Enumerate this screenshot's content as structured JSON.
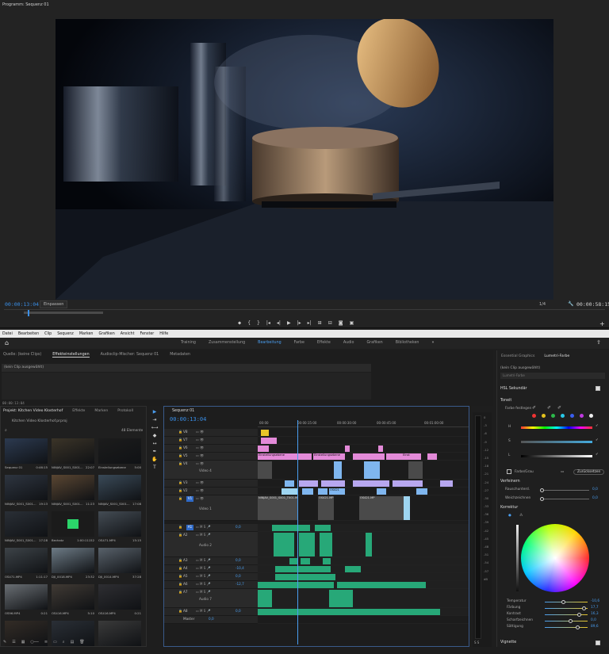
{
  "program": {
    "title": "Programm: Sequenz 01",
    "timecode": "00:00:13:04",
    "fit": "Einpassen",
    "quality": "1/4",
    "duration": "00:00:58:15"
  },
  "menu": [
    "Datei",
    "Bearbeiten",
    "Clip",
    "Sequenz",
    "Marken",
    "Grafiken",
    "Ansicht",
    "Fenster",
    "Hilfe"
  ],
  "workspaces": {
    "items": [
      "Training",
      "Zusammenstellung",
      "Bearbeitung",
      "Farbe",
      "Effekte",
      "Audio",
      "Grafiken",
      "Bibliotheken"
    ],
    "active": "Bearbeitung",
    "more": "»"
  },
  "source_panel": {
    "tabs": [
      "Quelle: (keine Clips)",
      "Effekteinstellungen",
      "Audioclip-Mischer: Sequenz 01",
      "Metadaten"
    ],
    "active": "Effekteinstellungen",
    "no_clip": "(kein Clip ausgewählt)",
    "timecode": "00:00:13:04"
  },
  "project": {
    "tabs": [
      "Projekt: Kitchen Video Klosterhof",
      "Effekte",
      "Marken",
      "Protokoll"
    ],
    "active": "Projekt: Kitchen Video Klosterhof",
    "file": "Kitchen Video Klosterhof.prproj",
    "count": "48 Elemente",
    "items": [
      {
        "name": "Sequenz 01",
        "dur": "0:46:15"
      },
      {
        "name": "NINJAV_S001_S001...",
        "dur": "22:07"
      },
      {
        "name": "Einstellungsebene",
        "dur": "5:00"
      },
      {
        "name": "NINJAV_S001_S001...",
        "dur": "19:13"
      },
      {
        "name": "NINJAV_S001_S001...",
        "dur": "11:23"
      },
      {
        "name": "NINJAV_S001_S001...",
        "dur": "17:08"
      },
      {
        "name": "NINJAV_S001_S001...",
        "dur": "17:28"
      },
      {
        "name": "Bechatz",
        "dur": "1:00:11152"
      },
      {
        "name": "OS471.MP4",
        "dur": "15:15"
      },
      {
        "name": "OS471.MP4",
        "dur": "1:11:17"
      },
      {
        "name": "DJI_0018.MP4",
        "dur": "23:32"
      },
      {
        "name": "DJI_0014.MP4",
        "dur": "37:28"
      },
      {
        "name": "OS96.MP4",
        "dur": "0:21"
      },
      {
        "name": "OS416.MP4",
        "dur": "5:10"
      },
      {
        "name": "OS416.MP4",
        "dur": "0:21"
      },
      {
        "name": "",
        "dur": ""
      },
      {
        "name": "",
        "dur": ""
      },
      {
        "name": "",
        "dur": ""
      }
    ]
  },
  "sequence": {
    "title": "Sequenz 01",
    "timecode": "00:00:13:04",
    "ruler": [
      "00:00",
      "00:00:15:00",
      "00:00:30:00",
      "00:00:45:00",
      "00:01:00:00"
    ],
    "video_tracks": [
      {
        "id": "V8",
        "name": ""
      },
      {
        "id": "V7",
        "name": ""
      },
      {
        "id": "V6",
        "name": ""
      },
      {
        "id": "V5",
        "name": ""
      },
      {
        "id": "V4",
        "name": "Video 4"
      },
      {
        "id": "V3",
        "name": ""
      },
      {
        "id": "V2",
        "name": ""
      },
      {
        "id": "V1",
        "name": "Video 1"
      }
    ],
    "audio_tracks": [
      {
        "id": "A1",
        "vol": "0,0"
      },
      {
        "id": "A2",
        "name": "Audio 2",
        "vol": ""
      },
      {
        "id": "A3",
        "vol": "0,0"
      },
      {
        "id": "A4",
        "vol": "-10,4"
      },
      {
        "id": "A5",
        "vol": "0,0"
      },
      {
        "id": "A6",
        "vol": "-12,7"
      },
      {
        "id": "A7",
        "name": "Audio 7",
        "vol": ""
      },
      {
        "id": "A8",
        "vol": "0,0"
      }
    ],
    "master": {
      "label": "Master",
      "vol": "0,0"
    },
    "clips": {
      "einstellungsebene": "Einstellungsebene",
      "ninjav": "NINJAV_S001_S001_T001.MO",
      "os421": "OS421.MP",
      "os421b": "OS421",
      "e": "Einst"
    }
  },
  "meter": {
    "scale": [
      "0",
      "-3",
      "-6",
      "-9",
      "-12",
      "-15",
      "-18",
      "-21",
      "-24",
      "-27",
      "-30",
      "-33",
      "-36",
      "-39",
      "-42",
      "-45",
      "-48",
      "-51",
      "-54",
      "-57",
      "dB"
    ],
    "solo": "S S"
  },
  "lumetri": {
    "tabs": [
      "Essential Graphics",
      "Lumetri-Farbe"
    ],
    "active": "Lumetri-Farbe",
    "no_clip": "(kein Clip ausgewählt)",
    "fx_placeholder": "Lumetri-Farbe",
    "hsl": "HSL Sekundär",
    "key": "Toneit",
    "set_color": "Farbe festlegen",
    "h": "H",
    "s": "S",
    "l": "L",
    "color_gray": "Farbe/Grau",
    "reset": "Zurücksetzen",
    "refine": "Verfeinern",
    "denoise": "Rauschunterd.",
    "denoise_val": "0,0",
    "blur": "Weichzeichnen",
    "blur_val": "0,0",
    "correction": "Korrektur",
    "params": [
      {
        "label": "Temperatur",
        "value": "-10,6"
      },
      {
        "label": "Färbung",
        "value": "17,7"
      },
      {
        "label": "Kontrast",
        "value": "16,3"
      },
      {
        "label": "Scharfzeichnen",
        "value": "0,0"
      },
      {
        "label": "Sättigung",
        "value": "89,6"
      }
    ],
    "vignette": "Vignette"
  },
  "colors": {
    "accent": "#3a8ee6",
    "pink": "#e38ad8",
    "violet": "#b7a7ef",
    "green": "#27a878"
  }
}
